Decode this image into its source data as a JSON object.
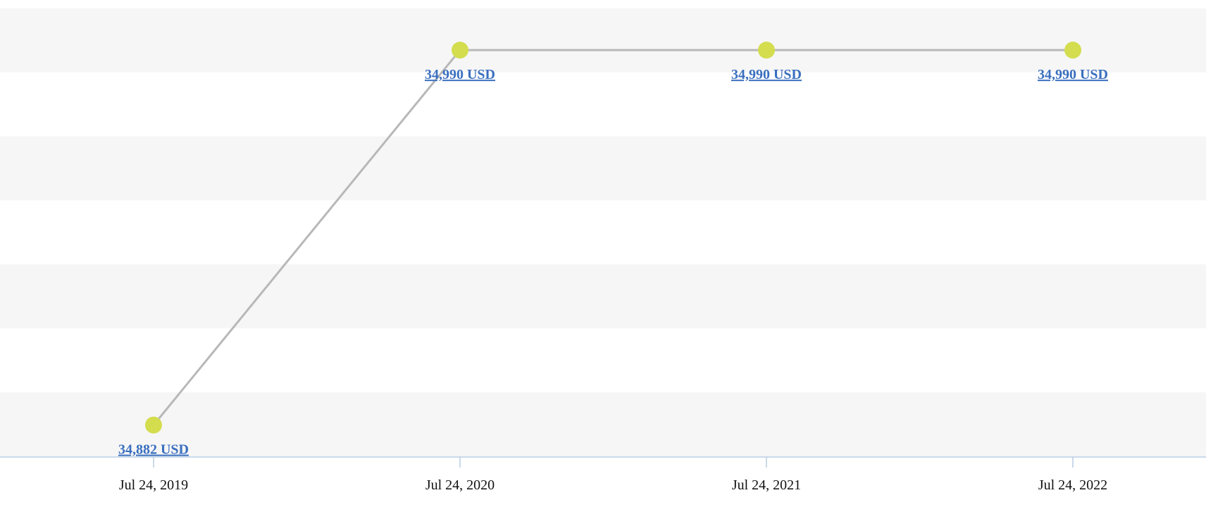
{
  "chart_data": {
    "type": "line",
    "title": "",
    "xlabel": "",
    "ylabel": "",
    "x": [
      "Jul 24, 2019",
      "Jul 24, 2020",
      "Jul 24, 2021",
      "Jul 24, 2022"
    ],
    "series": [
      {
        "values": [
          34882,
          34990,
          34990,
          34990
        ],
        "data_labels": [
          "34,882 USD",
          "34,990 USD",
          "34,990 USD",
          "34,990 USD"
        ]
      }
    ],
    "ylim": [
      34873,
      35002
    ],
    "grid": "horizontal alternating bands",
    "legend": "none",
    "y_axis_ticks_shown": false
  },
  "colors": {
    "point": "#d3dd4e",
    "line": "#b8b8b8",
    "label": "#3a6fbf",
    "band": "#f6f6f6",
    "axis": "#b9cde3",
    "tick_text": "#111111"
  }
}
